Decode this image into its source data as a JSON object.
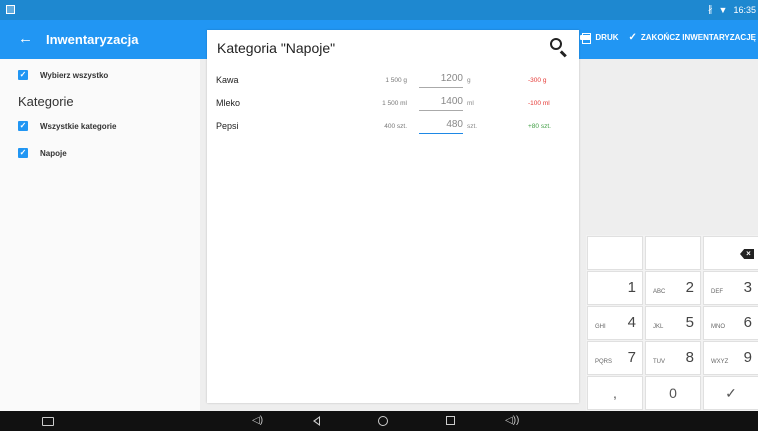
{
  "appbar": {
    "title": "Inwentaryzacja",
    "back_icon": "arrow-back-icon",
    "print_label": "DRUK",
    "finish_label": "ZAKOŃCZ INWENTARYZACJĘ"
  },
  "statusbar": {
    "time": "16:35",
    "icons": [
      "bluetooth-icon",
      "wifi-icon"
    ]
  },
  "sidebar": {
    "select_all": "Wybierz wszystko",
    "section_title": "Kategorie",
    "items": [
      {
        "label": "Wszystkie kategorie",
        "checked": true
      },
      {
        "label": "Napoje",
        "checked": true
      }
    ]
  },
  "main": {
    "title": "Kategoria \"Napoje\"",
    "rows": [
      {
        "name": "Kawa",
        "current": "1 500 g",
        "input": "1200",
        "unit": "g",
        "diff": "-300 g",
        "diff_sign": "neg"
      },
      {
        "name": "Mleko",
        "current": "1 500 ml",
        "input": "1400",
        "unit": "ml",
        "diff": "-100 ml",
        "diff_sign": "neg"
      },
      {
        "name": "Pepsi",
        "current": "400 szt.",
        "input": "480",
        "unit": "szt.",
        "diff": "+80 szt.",
        "diff_sign": "pos"
      }
    ]
  },
  "keypad": {
    "keys": [
      {
        "num": "1",
        "letters": ""
      },
      {
        "num": "2",
        "letters": "ABC"
      },
      {
        "num": "3",
        "letters": "DEF"
      },
      {
        "num": "4",
        "letters": "GHI"
      },
      {
        "num": "5",
        "letters": "JKL"
      },
      {
        "num": "6",
        "letters": "MNO"
      },
      {
        "num": "7",
        "letters": "PQRS"
      },
      {
        "num": "8",
        "letters": "TUV"
      },
      {
        "num": "9",
        "letters": "WXYZ"
      },
      {
        "num": ",",
        "letters": ""
      },
      {
        "num": "0",
        "letters": ""
      },
      {
        "num": "✓",
        "letters": ""
      }
    ]
  },
  "colors": {
    "primary": "#2196f3",
    "statusbar": "#1e88d0",
    "negative": "#e53935",
    "positive": "#43a047"
  }
}
